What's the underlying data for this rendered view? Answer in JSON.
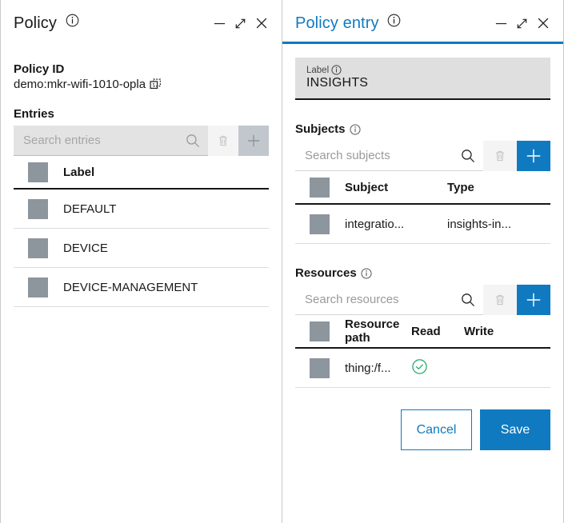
{
  "left_panel": {
    "title": "Policy",
    "title_info_icon": "info-icon",
    "window_controls": {
      "minimize": "minimize-icon",
      "expand": "expand-icon",
      "close": "close-icon"
    },
    "policy_id_label": "Policy ID",
    "policy_id_value": "demo:mkr-wifi-1010-opla",
    "copy_icon": "copy-icon",
    "entries_label": "Entries",
    "search": {
      "placeholder": "Search entries",
      "value": "",
      "search_icon": "search-icon",
      "delete_icon": "trash-icon",
      "add_icon": "plus-icon",
      "disabled": true
    },
    "table": {
      "columns": [
        "Label"
      ],
      "rows": [
        {
          "label": "DEFAULT"
        },
        {
          "label": "DEVICE"
        },
        {
          "label": "DEVICE-MANAGEMENT"
        }
      ]
    }
  },
  "right_panel": {
    "title": "Policy entry",
    "title_info_icon": "info-icon",
    "window_controls": {
      "minimize": "minimize-icon",
      "expand": "expand-icon",
      "close": "close-icon"
    },
    "label_field": {
      "caption": "Label",
      "caption_info_icon": "info-icon",
      "value": "INSIGHTS"
    },
    "subjects": {
      "heading": "Subjects",
      "heading_info_icon": "info-icon",
      "search": {
        "placeholder": "Search subjects",
        "value": "",
        "search_icon": "search-icon",
        "delete_icon": "trash-icon",
        "add_icon": "plus-icon"
      },
      "columns": [
        "Subject",
        "Type"
      ],
      "rows": [
        {
          "subject": "integratio...",
          "type": "insights-in..."
        }
      ]
    },
    "resources": {
      "heading": "Resources",
      "heading_info_icon": "info-icon",
      "search": {
        "placeholder": "Search resources",
        "value": "",
        "search_icon": "search-icon",
        "delete_icon": "trash-icon",
        "add_icon": "plus-icon"
      },
      "columns": [
        "Resource path",
        "Read",
        "Write"
      ],
      "rows": [
        {
          "path": "thing:/f...",
          "read": "check-circle-icon",
          "write": ""
        }
      ]
    },
    "buttons": {
      "cancel": "Cancel",
      "save": "Save"
    }
  },
  "colors": {
    "accent_blue": "#0f7ac0",
    "grey_square": "#8d959d",
    "disabled_grey": "#c1c7cd",
    "field_grey": "#dfdfdf",
    "success_green": "#25a56a"
  }
}
